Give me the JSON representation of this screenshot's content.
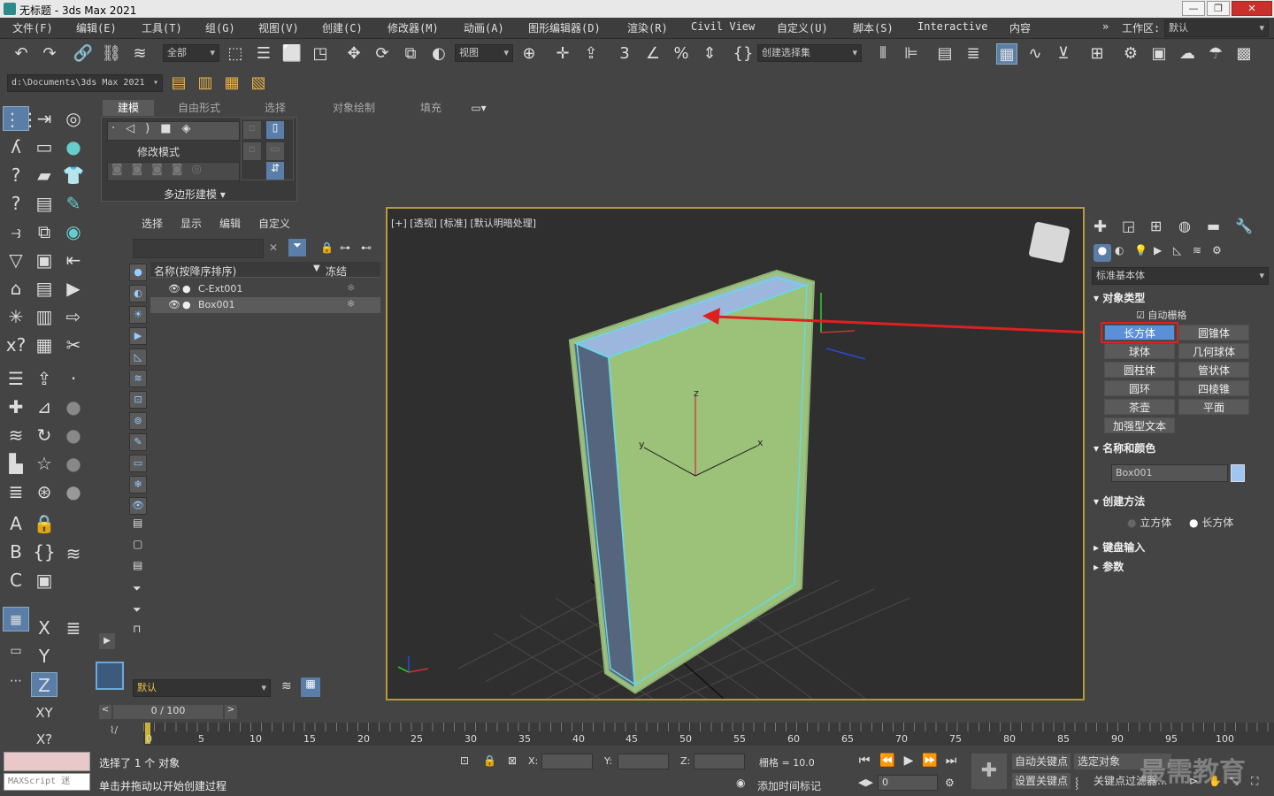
{
  "title": "无标题 - 3ds Max 2021",
  "menus": [
    "文件(F)",
    "编辑(E)",
    "工具(T)",
    "组(G)",
    "视图(V)",
    "创建(C)",
    "修改器(M)",
    "动画(A)",
    "图形编辑器(D)",
    "渲染(R)",
    "Civil View",
    "自定义(U)",
    "脚本(S)",
    "Interactive",
    "内容"
  ],
  "workspace": {
    "label": "工作区:",
    "value": "默认"
  },
  "toolbar": {
    "filter": "全部",
    "ref_coord": "视图",
    "selection_set": "创建选择集",
    "path": "d:\\Documents\\3ds Max 2021"
  },
  "ribbon": {
    "tabs": [
      "建模",
      "自由形式",
      "选择",
      "对象绘制",
      "填充"
    ],
    "modify_mode": "修改模式",
    "poly_modeling": "多边形建模"
  },
  "scene_explorer": {
    "menus": [
      "选择",
      "显示",
      "编辑",
      "自定义"
    ],
    "col_name": "名称(按降序排序)",
    "col_freeze": "冻结",
    "rows": [
      {
        "name": "C-Ext001",
        "selected": false
      },
      {
        "name": "Box001",
        "selected": true
      }
    ],
    "layer": "默认"
  },
  "viewport": {
    "label": "[+] [透视] [标准] [默认明暗处理]",
    "gizmo": {
      "x": "x",
      "y": "y",
      "z": "z"
    }
  },
  "command_panel": {
    "category": "标准基本体",
    "object_type": "对象类型",
    "autogrid": "自动栅格",
    "buttons": [
      "长方体",
      "圆锥体",
      "球体",
      "几何球体",
      "圆柱体",
      "管状体",
      "圆环",
      "四棱锥",
      "茶壶",
      "平面",
      "加强型文本"
    ],
    "name_color": "名称和颜色",
    "object_name": "Box001",
    "object_color": "#9fc5f0",
    "creation_method": "创建方法",
    "methods": [
      "立方体",
      "长方体"
    ],
    "selected_method": "长方体",
    "keyboard_input": "键盘输入",
    "params": "参数"
  },
  "timeline": {
    "frame": "0 / 100",
    "ticks": [
      "0",
      "5",
      "10",
      "15",
      "20",
      "25",
      "30",
      "35",
      "40",
      "45",
      "50",
      "55",
      "60",
      "65",
      "70",
      "75",
      "80",
      "85",
      "90",
      "95",
      "100"
    ]
  },
  "status": {
    "selected": "选择了 1 个 对象",
    "prompt": "单击并拖动以开始创建过程",
    "maxscript": "MAXScript 迷",
    "x_label": "X:",
    "y_label": "Y:",
    "z_label": "Z:",
    "grid": "栅格 = 10.0",
    "add_time_tag": "添加时间标记",
    "auto_key": "自动关键点",
    "selected_obj": "选定对象",
    "set_key": "设置关键点",
    "key_filters": "关键点过滤器...",
    "frame_value": "0"
  },
  "watermark": "最需教育",
  "colors": {
    "accent": "#6fa8dc",
    "highlight_red": "#e02020",
    "selection_border": "#b59a3d"
  }
}
